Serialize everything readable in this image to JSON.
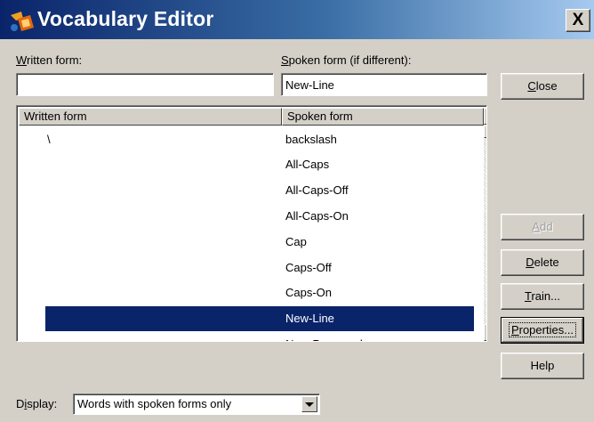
{
  "window": {
    "title": "Vocabulary Editor",
    "close_glyph": "X",
    "icon": "app-icon"
  },
  "fields": {
    "written_label_u": "W",
    "written_label_rest": "ritten form:",
    "written_value": "",
    "spoken_label_u": "S",
    "spoken_label_rest": "poken form (if different):",
    "spoken_value": "New-Line"
  },
  "list": {
    "headers": {
      "written": "Written form",
      "spoken": "Spoken form"
    },
    "rows": [
      {
        "written": "\\",
        "spoken": "backslash"
      },
      {
        "written": "",
        "spoken": "All-Caps"
      },
      {
        "written": "",
        "spoken": "All-Caps-Off"
      },
      {
        "written": "",
        "spoken": "All-Caps-On"
      },
      {
        "written": "",
        "spoken": "Cap"
      },
      {
        "written": "",
        "spoken": "Caps-Off"
      },
      {
        "written": "",
        "spoken": "Caps-On"
      },
      {
        "written": "",
        "spoken": "New-Line"
      },
      {
        "written": "",
        "spoken": "New-Paragraph"
      }
    ],
    "selected_spoken": "New-Line"
  },
  "buttons": {
    "close_u": "C",
    "close_rest": "lose",
    "add_u": "A",
    "add_rest": "dd",
    "delete_u": "D",
    "delete_rest": "elete",
    "train_u": "T",
    "train_rest": "rain...",
    "properties_u": "P",
    "properties_rest": "roperties...",
    "help": "Help"
  },
  "display": {
    "label_pre": "D",
    "label_u": "i",
    "label_rest": "splay:",
    "value": "Words with spoken forms only"
  },
  "colors": {
    "selection": "#0a246a",
    "face": "#d4d0c8",
    "title_start": "#0a246a",
    "title_end": "#a6caf0"
  }
}
